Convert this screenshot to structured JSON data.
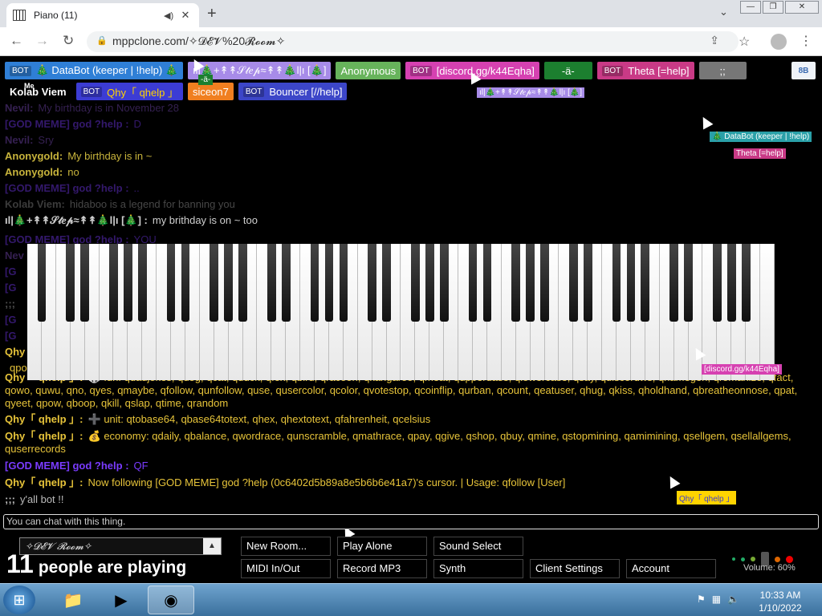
{
  "browser": {
    "tab_title": "Piano (11)",
    "url": "mppclone.com/✧𝓓𝓔𝓥%20𝓡𝓸𝓸𝓶✧"
  },
  "players": {
    "row1": [
      {
        "bot": "BOT",
        "name": "🎄 DataBot (keeper | !help) 🎄",
        "color": "#2f7fd6"
      },
      {
        "bot": "",
        "name": "ıl|🎄+↟↟𝒮𝓉𝑒𝓅≈↟↟🎄l|ı [🎄]",
        "color": "#a78be8"
      },
      {
        "bot": "",
        "name": "Anonymous",
        "color": "#67b35b"
      },
      {
        "bot": "BOT",
        "name": "[discord.gg/k44Eqha]",
        "color": "#d641b1"
      },
      {
        "bot": "",
        "name": "-ä-",
        "color": "#1c7f2f"
      },
      {
        "bot": "BOT",
        "name": "Theta [=help]",
        "color": "#c93a86"
      },
      {
        "bot": "",
        "name": ";;",
        "color": "#777777"
      }
    ],
    "row2": [
      {
        "bot": "",
        "name": "Kolab Viem",
        "color": "transparent"
      },
      {
        "bot": "BOT",
        "name": "Qhy「 qhelp 」",
        "color": "#3c3cd4"
      },
      {
        "bot": "",
        "name": "siceon7",
        "color": "#f07f20"
      },
      {
        "bot": "BOT",
        "name": "Bouncer [//help]",
        "color": "#3c46c8"
      }
    ],
    "badge_me": "Me",
    "sb_button": "8B"
  },
  "chat": {
    "messages": [
      {
        "who": "Nevil:",
        "text": "My birthday is in November 28",
        "who_class": "c-nevil",
        "dim": true
      },
      {
        "who": "[GOD MEME] god ?help :",
        "text": "D",
        "who_class": "c-god",
        "dim": true
      },
      {
        "who": "Nevil:",
        "text": "Sry",
        "who_class": "c-nevil",
        "dim": true
      },
      {
        "who": "Anonygold:",
        "text": "My birthday is in ~",
        "who_class": "c-anon",
        "dim": false
      },
      {
        "who": "Anonygold:",
        "text": "no",
        "who_class": "c-anon",
        "dim": false
      },
      {
        "who": "[GOD MEME] god ?help :",
        "text": "..",
        "who_class": "c-god",
        "dim": true
      },
      {
        "who": "Kolab Viem:",
        "text": "hidaboo is a legend for banning you",
        "who_class": "c-kolab",
        "dim": true
      },
      {
        "who": "ıl|🎄+↟↟𝒮𝓉𝑒𝓅≈↟↟🎄l|ı [🎄] :",
        "text": "my brithday is on ~ too",
        "who_class": "c-step",
        "dim": false
      },
      {
        "who": "[GOD MEME] god ?help :",
        "text": "YOU",
        "who_class": "c-god",
        "dim": true
      },
      {
        "who": "Nev",
        "text": "",
        "who_class": "c-nevil",
        "dim": true
      },
      {
        "who": "[G",
        "text": "",
        "who_class": "c-god",
        "dim": true
      },
      {
        "who": "[G",
        "text": "",
        "who_class": "c-god",
        "dim": true
      },
      {
        "who": ";;;",
        "text": "",
        "who_class": "c-semi",
        "dim": true
      },
      {
        "who": "[G",
        "text": "",
        "who_class": "c-god",
        "dim": true
      },
      {
        "who": "[G",
        "text": "",
        "who_class": "c-god",
        "dim": true
      },
      {
        "who": "Qhy",
        "text": "",
        "who_class": "c-qhy",
        "dim": false,
        "tail": "k,"
      },
      {
        "who": "",
        "text": "qpo",
        "who_class": "c-qhy",
        "dim": false
      }
    ],
    "wrapped": [
      {
        "who": "Qhy「 qhelp 」:",
        "text": "🎲 fun: qdadjokes, qdog, qcat, qduck, qfox, qbird, qracoon, qkangaroo, qmeat, qupperdase, qlowercase, qsay, qdiscordws, qnamegen, qromanize, qfact, qowo, quwu, qno, qyes, qmaybe, qfollow, qunfollow, quse, qusercolor, qcolor, qvotestop, qcoinflip, qurban, qcount, qeatuser, qhug, qkiss, qholdhand, qbreatheonnose, qpat, qyeet, qpow, qboop, qkill, qslap, qtime, qrandom",
        "who_class": "c-qhy"
      },
      {
        "who": "Qhy「 qhelp 」:",
        "text": "➕ unit: qtobase64, qbase64totext, qhex, qhextotext, qfahrenheit, qcelsius",
        "who_class": "c-qhy"
      },
      {
        "who": "Qhy「 qhelp 」:",
        "text": "💰 economy: qdaily, qbalance, qwordrace, qunscramble, qmathrace, qpay, qgive, qshop, qbuy, qmine, qstopmining, qamimining, qsellgem, qsellallgems, quserrecords",
        "who_class": "c-qhy"
      },
      {
        "who": "[GOD MEME] god ?help :",
        "text": "QF",
        "who_class": "c-god"
      },
      {
        "who": "Qhy「 qhelp 」:",
        "text": "Now following [GOD MEME] god ?help (0c6402d5b89a8e5b6b6e41a7)'s cursor. | Usage: qfollow [User]",
        "who_class": "c-qhy"
      },
      {
        "who": ";;;",
        "text": "y'all bot !!",
        "who_class": "c-semi"
      }
    ],
    "input_placeholder": "You can chat with this thing."
  },
  "cursor_tags": {
    "step": "ıl|🎄+↟↟𝒮𝓉𝑒𝓅≈↟↟🎄l|ı [🎄]",
    "databot": "🎄 DataBot (keeper | !help)",
    "theta": "Theta [=help]",
    "discord": "[discord.gg/k44Eqha]",
    "qhy": "Qhy「 qhelp 」",
    "a": "-ä-",
    "semi": ";;"
  },
  "controls": {
    "room_name": "✧𝓓𝓔𝓥 𝓡𝓸𝓸𝓶✧",
    "player_count": "11",
    "player_count_text": "people are playing",
    "buttons": {
      "new_room": "New Room...",
      "play_alone": "Play Alone",
      "sound_select": "Sound Select",
      "midi": "MIDI In/Out",
      "record": "Record MP3",
      "synth": "Synth",
      "client_settings": "Client Settings",
      "account": "Account"
    },
    "volume": "Volume: 60%"
  },
  "taskbar": {
    "time": "10:33 AM",
    "date": "1/10/2022"
  },
  "colors": {
    "god_meme": "#7a3bff",
    "qhy": "#e7c43a",
    "anonygold": "#c8b43c"
  }
}
